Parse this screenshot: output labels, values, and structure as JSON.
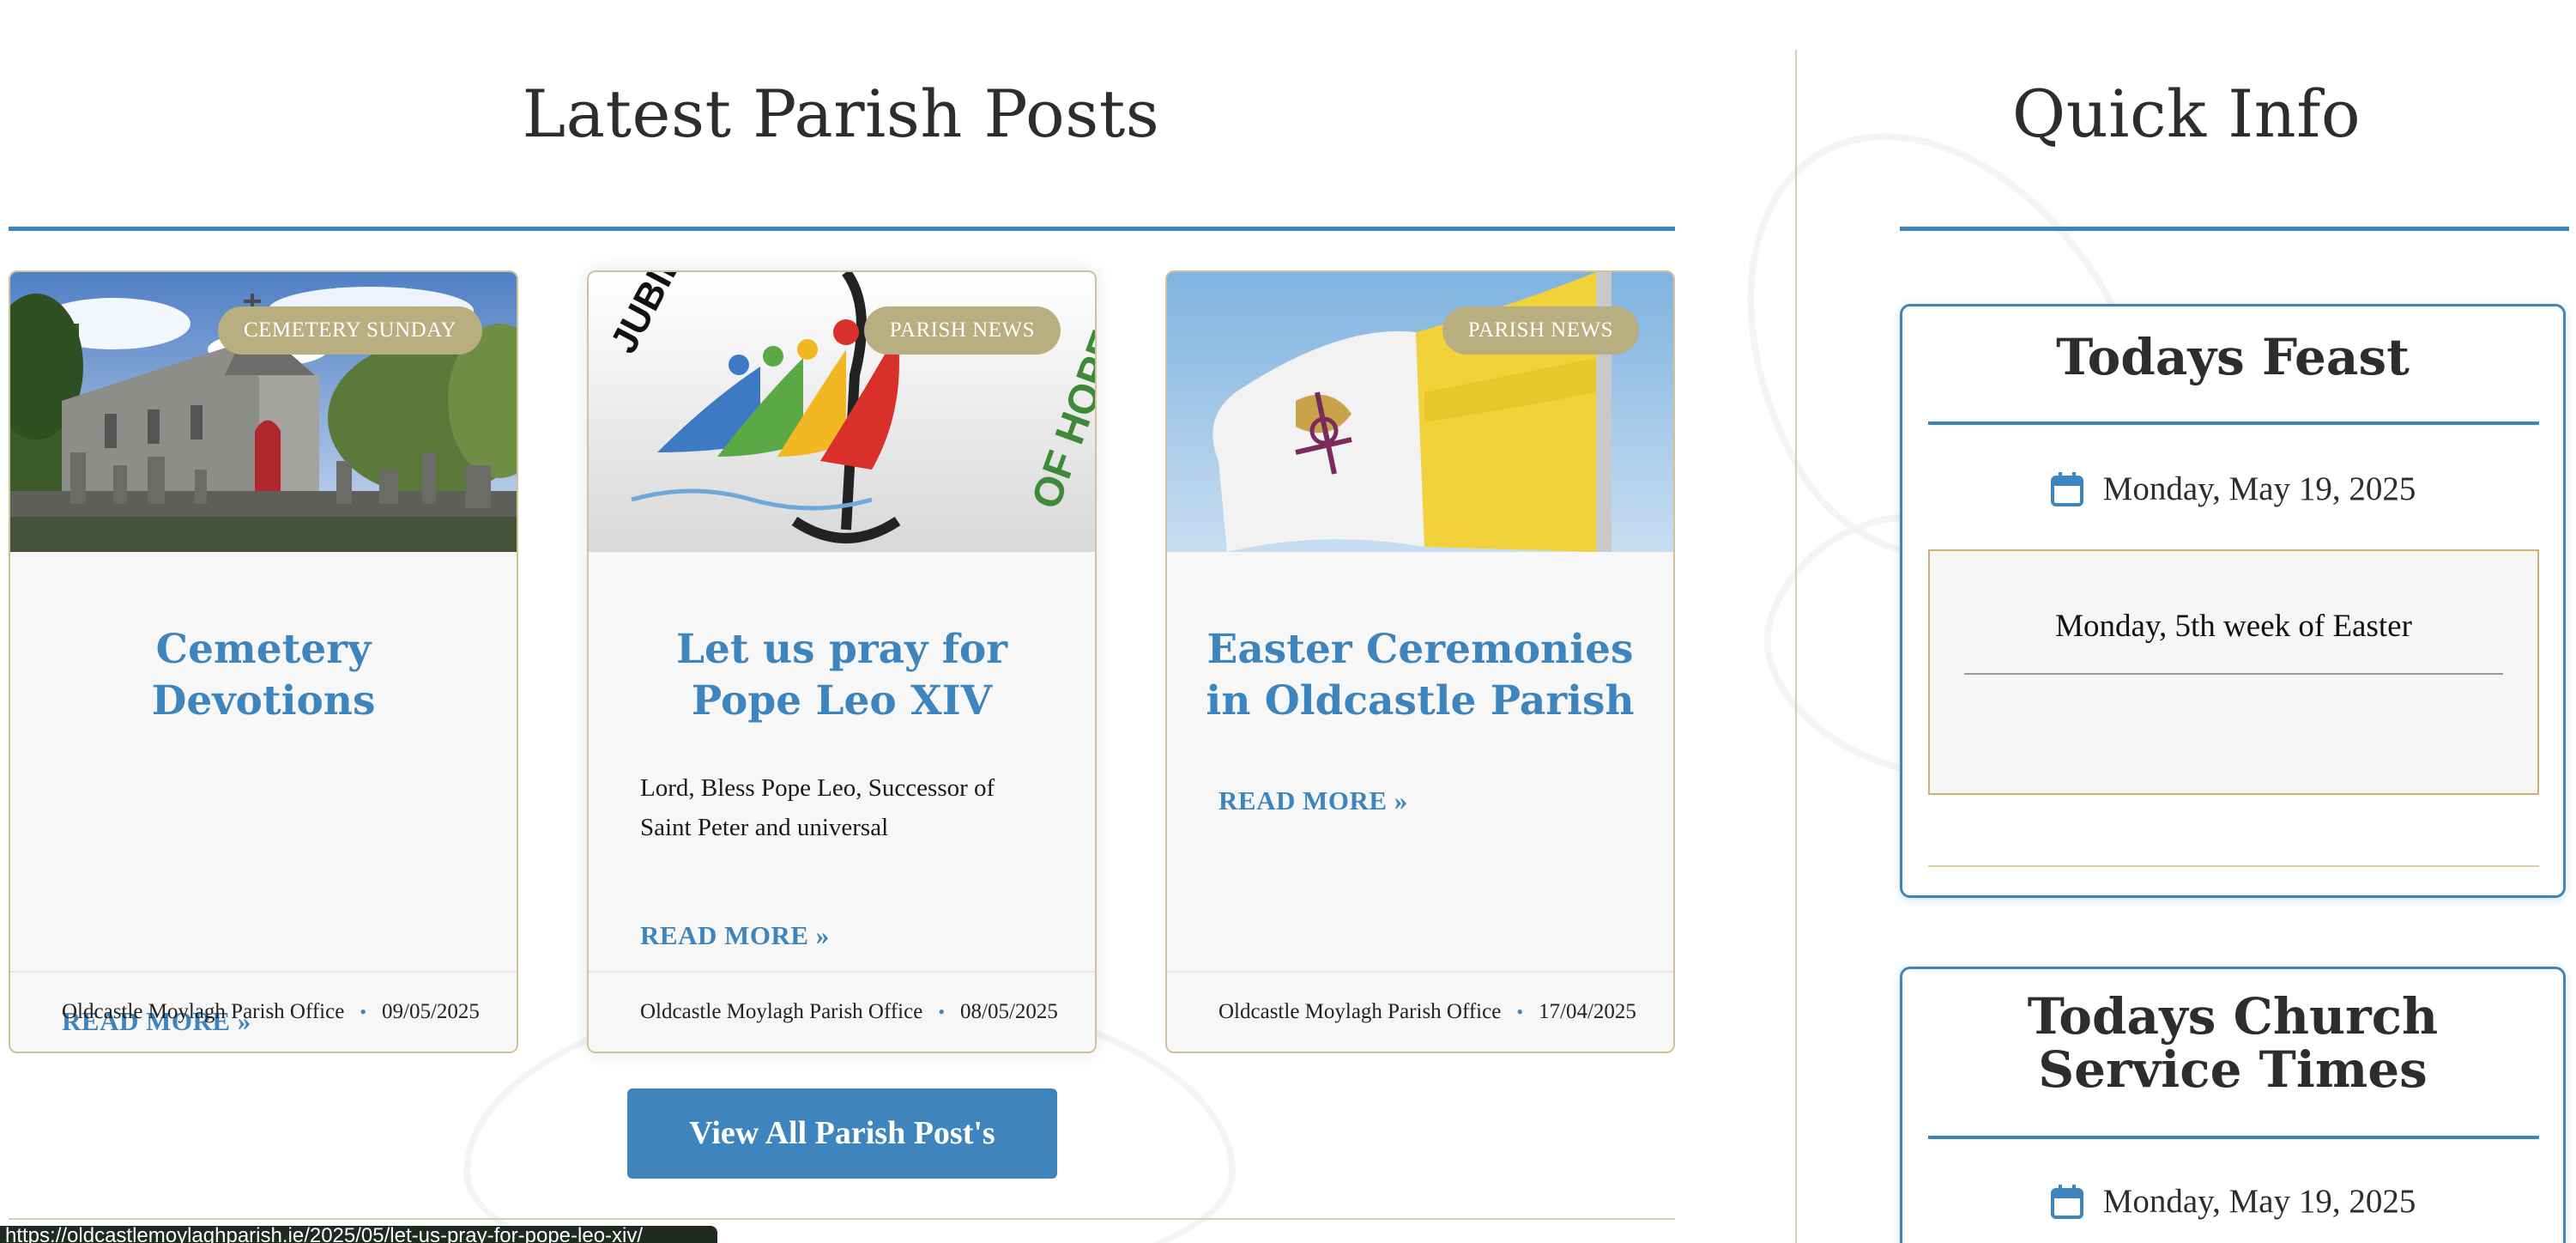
{
  "posts_section": {
    "title": "Latest Parish Posts",
    "view_all_label": "View All Parish Post's"
  },
  "posts": [
    {
      "category": "CEMETERY SUNDAY",
      "title": "Cemetery Devotions",
      "excerpt": "",
      "read_more": "READ MORE »",
      "author": "Oldcastle Moylagh Parish Office",
      "date": "09/05/2025"
    },
    {
      "category": "PARISH NEWS",
      "title": "Let us pray for Pope Leo XIV",
      "excerpt": "Lord, Bless Pope Leo, Successor of Saint Peter and universal",
      "read_more": "READ MORE »",
      "author": "Oldcastle Moylagh Parish Office",
      "date": "08/05/2025",
      "image_text_left": "JUBILE",
      "image_text_right": "OF HOPE"
    },
    {
      "category": "PARISH NEWS",
      "title": "Easter Ceremonies in Oldcastle Parish",
      "excerpt": "",
      "read_more": "READ MORE »",
      "author": "Oldcastle Moylagh Parish Office",
      "date": "17/04/2025"
    }
  ],
  "quick_info": {
    "title": "Quick Info",
    "feast": {
      "title": "Todays Feast",
      "date": "Monday, May 19, 2025",
      "text": "Monday, 5th week of Easter"
    },
    "services": {
      "title": "Todays Church Service Times",
      "date": "Monday, May 19, 2025"
    }
  },
  "status_bar": {
    "url": "https://oldcastlemoylaghparish.ie/2025/05/let-us-pray-for-pope-leo-xiv/"
  },
  "colors": {
    "accent_blue": "#3e84bd",
    "badge_gold": "#b9ae80",
    "border_gold": "#cfc397"
  },
  "icons": {
    "date": "calendar-icon"
  }
}
